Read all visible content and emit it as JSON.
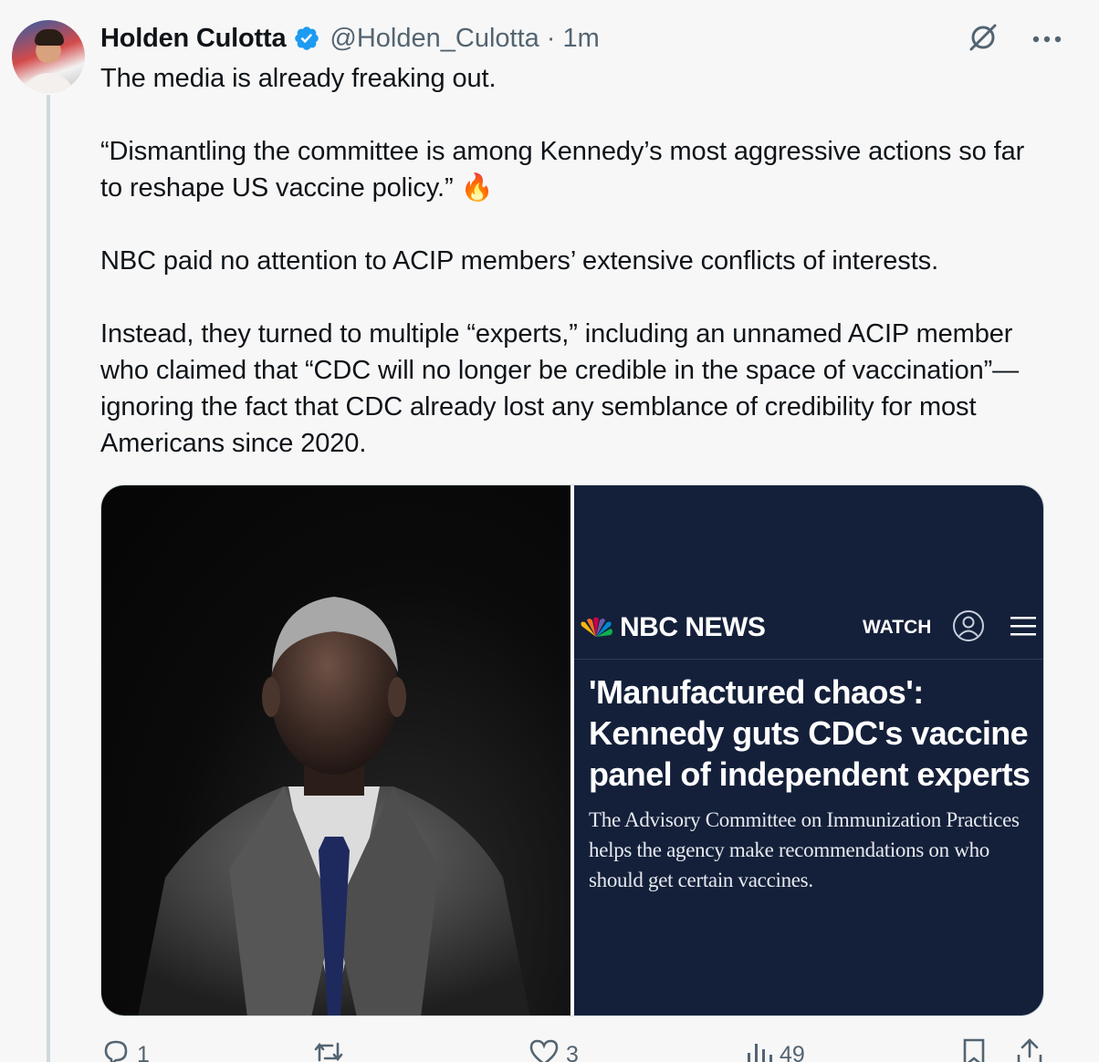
{
  "author": {
    "name": "Holden Culotta",
    "handle": "@Holden_Culotta",
    "time": "· 1m",
    "verified": true
  },
  "post": {
    "text": "The media is already freaking out.\n\n“Dismantling the committee is among Kennedy’s most aggressive actions so far to reshape US vaccine policy.” 🔥\n\nNBC paid no attention to ACIP members’ extensive conflicts of interests.\n\nInstead, they turned to multiple “experts,” including an unnamed ACIP member who claimed that “CDC will no longer be credible in the space of vaccination”—ignoring the fact that CDC already lost any semblance of credibility for most Americans since 2020."
  },
  "media": {
    "right_article": {
      "brand": "NBC NEWS",
      "watch_label": "WATCH",
      "headline": "'Manufactured chaos': Kennedy guts CDC's vaccine panel of independent experts",
      "dek": "The Advisory Committee on Immunization Practices helps the agency make recommendations on who should get certain vaccines."
    }
  },
  "actions": {
    "replies": "1",
    "reposts": "",
    "likes": "3",
    "views": "49"
  },
  "icons": {
    "top_right": [
      "grok-icon",
      "more-icon"
    ],
    "action_bar": [
      "reply-icon",
      "repost-icon",
      "like-icon",
      "views-icon",
      "bookmark-icon",
      "share-icon"
    ]
  },
  "colors": {
    "verified": "#1d9bf0",
    "muted_text": "#536471",
    "nbc_background": "#14203a"
  }
}
